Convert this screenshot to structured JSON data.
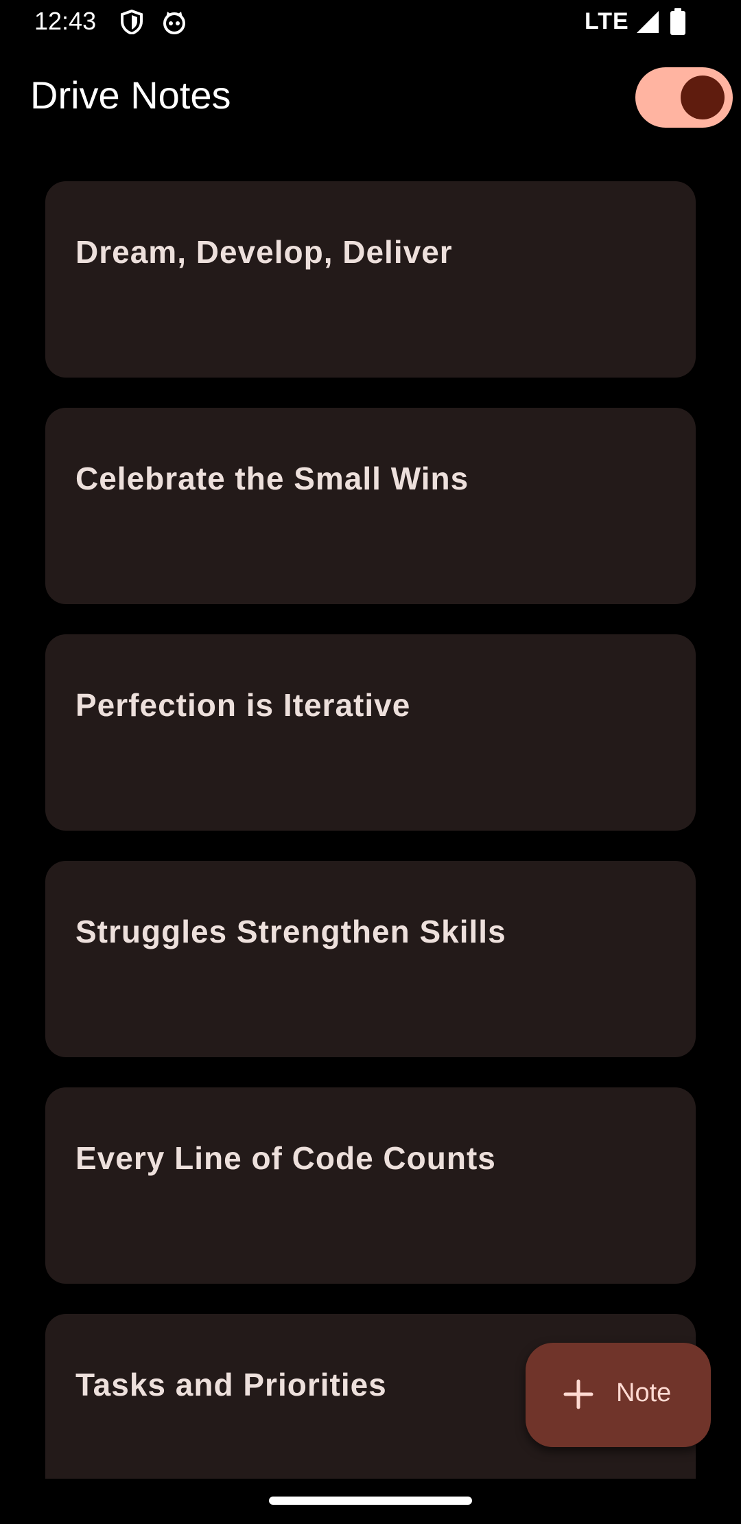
{
  "status_bar": {
    "time": "12:43",
    "network": "LTE",
    "icons": [
      "shield-icon",
      "cat-icon",
      "signal-icon",
      "battery-icon"
    ]
  },
  "app_bar": {
    "title": "Drive Notes",
    "toggle_state": "on"
  },
  "notes": [
    {
      "title": "Dream, Develop, Deliver"
    },
    {
      "title": "Celebrate the Small Wins"
    },
    {
      "title": "Perfection is Iterative"
    },
    {
      "title": "Struggles Strengthen Skills"
    },
    {
      "title": "Every Line of Code Counts"
    },
    {
      "title": "Tasks and Priorities"
    }
  ],
  "fab": {
    "label": "Note",
    "icon": "plus-icon"
  },
  "colors": {
    "background": "#000000",
    "card": "#231A19",
    "card_text": "#EDE0DC",
    "toggle_track": "#FFB4A1",
    "toggle_thumb": "#5F1C0E",
    "fab_bg": "#70342A",
    "fab_text": "#FFDAD2"
  }
}
